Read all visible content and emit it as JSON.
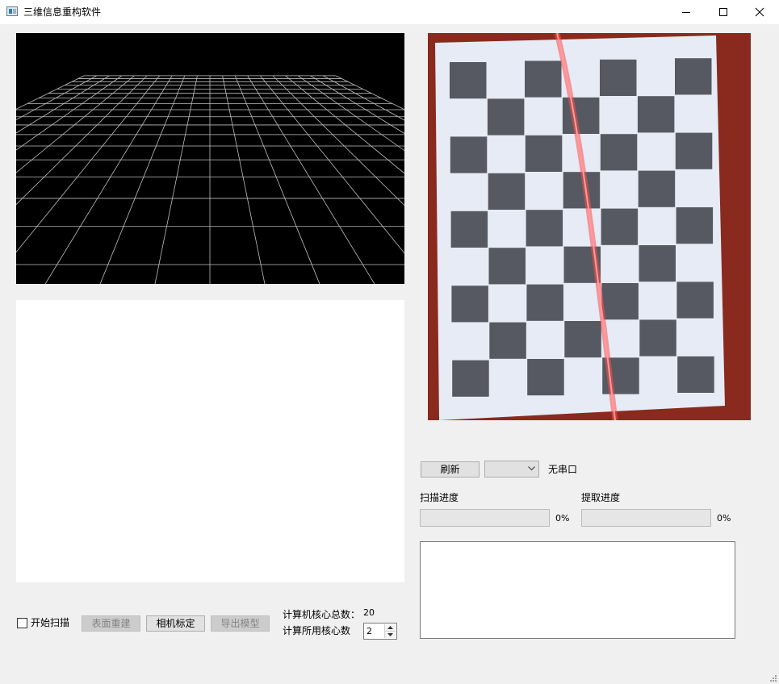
{
  "window": {
    "title": "三维信息重构软件",
    "icons": {
      "app": "app-window-icon",
      "minimize": "minimize-icon",
      "maximize": "maximize-icon",
      "close": "close-icon"
    }
  },
  "viewport_3d": {
    "background": "#000000",
    "grid_color": "#bfbfbf"
  },
  "camera_view": {
    "subject": "checkerboard calibration target with red laser line",
    "background": "#8a2a1e",
    "laser_color": "#ff3b3b"
  },
  "serial": {
    "refresh_label": "刷新",
    "port_select_value": "",
    "status": "无串口"
  },
  "progress": {
    "scan_label": "扫描进度",
    "scan_value": 0,
    "scan_text": "0%",
    "extract_label": "提取进度",
    "extract_value": 0,
    "extract_text": "0%"
  },
  "log_text": "",
  "controls": {
    "start_scan_label": "开始扫描",
    "start_scan_checked": false,
    "surface_rebuild_label": "表面重建",
    "camera_calibration_label": "相机标定",
    "export_model_label": "导出模型"
  },
  "cores": {
    "total_label": "计算机核心总数：",
    "total_value": "20",
    "used_label": "计算所用核心数",
    "used_value": "2"
  }
}
